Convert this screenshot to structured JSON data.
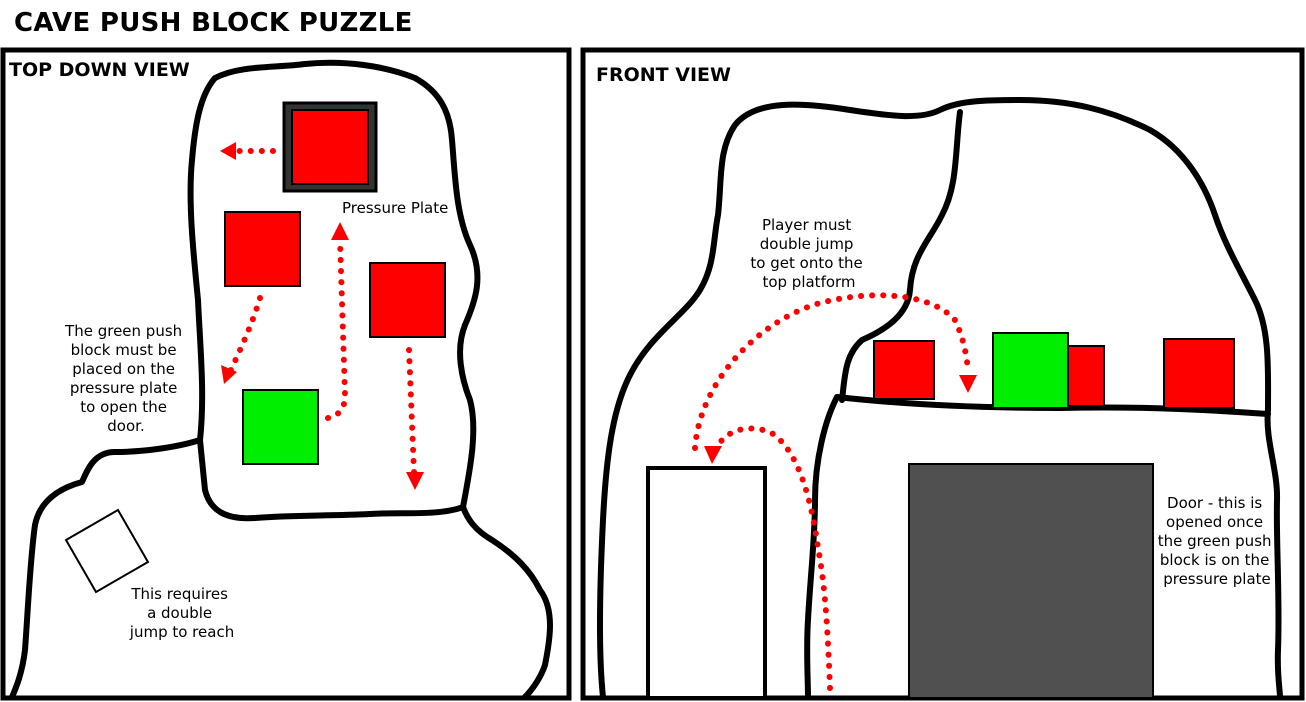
{
  "title": "CAVE PUSH BLOCK PUZZLE",
  "colors": {
    "block_red": "#ff0000",
    "block_green": "#00ee00",
    "door": "#505050",
    "pressure_plate": "#333333",
    "arrow": "#ff0000",
    "outline": "#000000"
  },
  "top_view": {
    "title": "TOP DOWN VIEW",
    "pressure_plate_label": "Pressure Plate",
    "green_note": [
      "The green push",
      "block must be",
      "placed on the",
      "pressure plate",
      "to open the",
      "door."
    ],
    "double_jump_note": [
      "This requires",
      "a double",
      "jump to reach"
    ]
  },
  "front_view": {
    "title": "FRONT VIEW",
    "player_note": [
      "Player must",
      "double jump",
      "to get onto the",
      "top platform"
    ],
    "door_note": [
      "Door - this is",
      "opened once",
      "the green push",
      "block is on the",
      "pressure plate"
    ]
  }
}
